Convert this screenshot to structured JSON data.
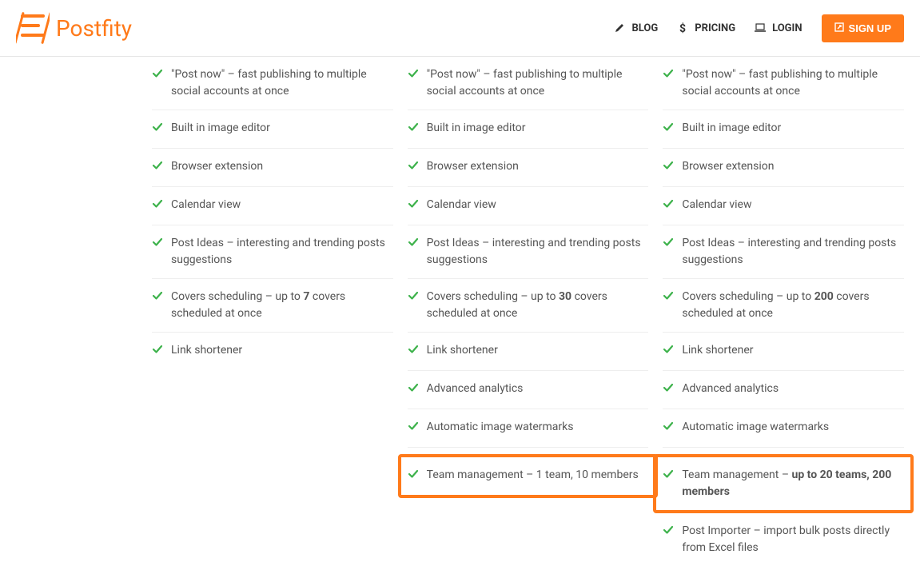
{
  "header": {
    "brand": "Postfity",
    "nav": {
      "blog": "BLOG",
      "pricing": "PRICING",
      "login": "LOGIN",
      "signup": "SIGN UP"
    }
  },
  "columns": [
    {
      "features": [
        {
          "text_pre": "\"Post now\" – fast publishing to multiple social accounts at once"
        },
        {
          "text_pre": "Built in image editor"
        },
        {
          "text_pre": "Browser extension"
        },
        {
          "text_pre": "Calendar view"
        },
        {
          "text_pre": "Post Ideas – interesting and trending posts suggestions"
        },
        {
          "text_pre": "Covers scheduling – up to ",
          "bold": "7",
          "text_post": " covers scheduled at once"
        },
        {
          "text_pre": "Link shortener"
        }
      ]
    },
    {
      "features": [
        {
          "text_pre": "\"Post now\" – fast publishing to multiple social accounts at once"
        },
        {
          "text_pre": "Built in image editor"
        },
        {
          "text_pre": "Browser extension"
        },
        {
          "text_pre": "Calendar view"
        },
        {
          "text_pre": "Post Ideas – interesting and trending posts suggestions"
        },
        {
          "text_pre": "Covers scheduling – up to ",
          "bold": "30",
          "text_post": " covers scheduled at once"
        },
        {
          "text_pre": "Link shortener"
        },
        {
          "text_pre": "Advanced analytics"
        },
        {
          "text_pre": "Automatic image watermarks"
        }
      ],
      "highlight": {
        "text_pre": "Team management – 1 team, 10 members"
      }
    },
    {
      "features": [
        {
          "text_pre": "\"Post now\" – fast publishing to multiple social accounts at once"
        },
        {
          "text_pre": "Built in image editor"
        },
        {
          "text_pre": "Browser extension"
        },
        {
          "text_pre": "Calendar view"
        },
        {
          "text_pre": "Post Ideas – interesting and trending posts suggestions"
        },
        {
          "text_pre": "Covers scheduling – up to ",
          "bold": "200",
          "text_post": " covers scheduled at once"
        },
        {
          "text_pre": "Link shortener"
        },
        {
          "text_pre": "Advanced analytics"
        },
        {
          "text_pre": "Automatic image watermarks"
        }
      ],
      "highlight": {
        "text_pre": "Team management – ",
        "bold": "up to 20 teams, 200 members"
      },
      "features_after": [
        {
          "text_pre": "Post Importer – import bulk posts directly from Excel files"
        }
      ]
    }
  ]
}
